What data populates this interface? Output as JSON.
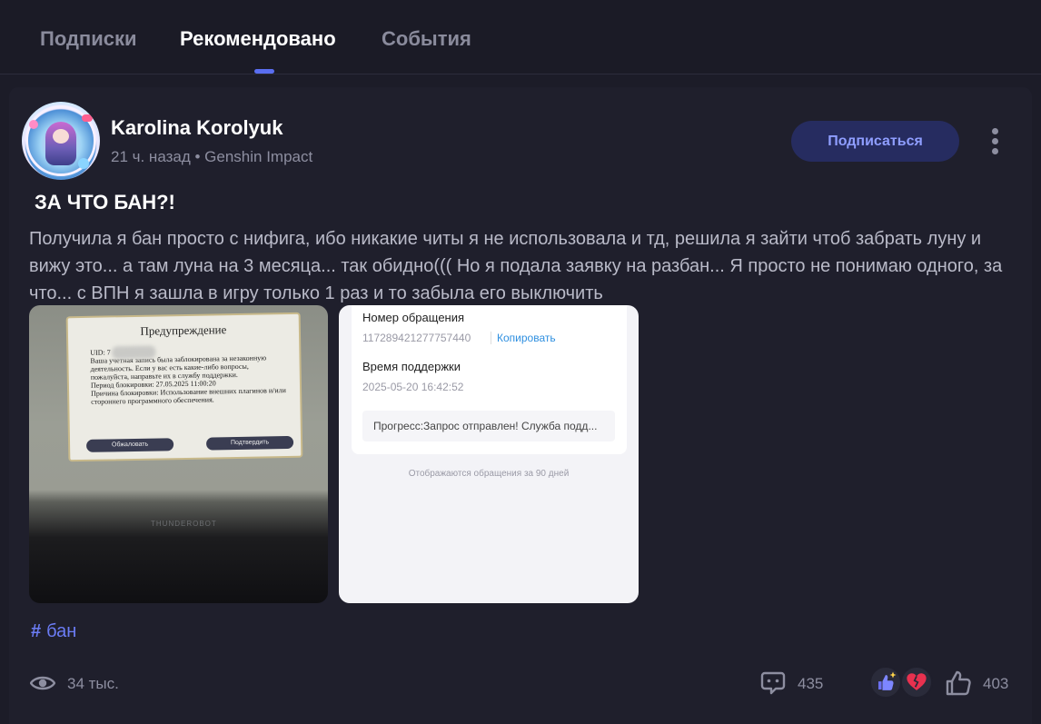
{
  "tabs": [
    {
      "label": "Подписки",
      "active": false
    },
    {
      "label": "Рекомендовано",
      "active": true
    },
    {
      "label": "События",
      "active": false
    }
  ],
  "colors": {
    "background": "#1c1c28",
    "card": "#1f1f2c",
    "accent": "#5a6ef0",
    "follow_bg": "#262c60",
    "follow_text": "#8f9eff",
    "tag": "#6b7cf5"
  },
  "post": {
    "author": "Karolina Korolyuk",
    "meta": "21 ч. назад • Genshin Impact",
    "follow_label": "Подписаться",
    "title": "ЗА ЧТО БАН?!",
    "body": "Получила я бан просто с нифига, ибо никакие читы я не использовала и тд, решила я зайти чтоб забрать луну и вижу это... а там луна на 3 месяца... так обидно((( Но я подала заявку на разбан... Я просто не понимаю одного, за что... с ВПН я зашла в игру только 1 раз и то забыла его выключить",
    "tag": "бан",
    "views": "34 тыс.",
    "comments": "435",
    "likes": "403"
  },
  "image1": {
    "title": "Предупреждение",
    "uid": "UID: 7",
    "text": "Ваша учетная запись была заблокирована за незаконную деятельность. Если у вас есть какие-либо вопросы, пожалуйста, направьте их в службу поддержки.",
    "period": "Период блокировки: 27.05.2025 11:00:20",
    "reason": "Причина блокировки: Использование внешних плагинов и/или стороннего программного обеспечения.",
    "appeal_button": "Обжаловать",
    "confirm_button": "Подтвердить",
    "brand": "THUNDEROBOT"
  },
  "image2": {
    "ticket_label": "Номер обращения",
    "ticket_number": "117289421277757440",
    "copy_label": "Копировать",
    "support_time_label": "Время поддержки",
    "support_time": "2025-05-20 16:42:52",
    "progress": "Прогресс:Запрос отправлен! Служба подд...",
    "footer": "Отображаются обращения за 90 дней"
  },
  "icons": {
    "views": "eye-icon",
    "comments": "comment-icon",
    "reaction1": "thumbs-up-sparkle-icon",
    "reaction2": "broken-heart-icon",
    "like": "thumbs-up-outline-icon",
    "more": "more-vertical-icon"
  }
}
